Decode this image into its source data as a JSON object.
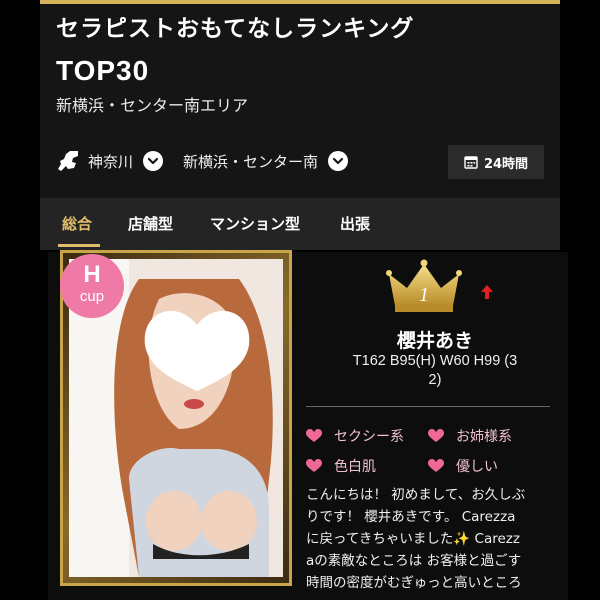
{
  "page": {
    "title_line1": "セラピストおもてなしランキング",
    "title_line2": "TOP30",
    "area": "新横浜・センター南エリア"
  },
  "filters": {
    "prefecture": "神奈川",
    "area": "新横浜・センター南",
    "hours": "24時間",
    "prefecture_icon": "kanagawa-map-icon",
    "chevron_icon": "chevron-down-icon",
    "calendar_icon": "calendar-icon"
  },
  "tabs": [
    {
      "label": "総合",
      "active": true
    },
    {
      "label": "店舗型",
      "active": false
    },
    {
      "label": "マンション型",
      "active": false
    },
    {
      "label": "出張",
      "active": false
    }
  ],
  "therapist": {
    "cup_letter": "H",
    "cup_label": "cup",
    "rank": "1",
    "rank_trend": "up",
    "name": "櫻井あき",
    "stats_line1": "T162 B95(H) W60 H99 (3",
    "stats_line2": "2)",
    "tags": [
      "セクシー系",
      "お姉様系",
      "色白肌",
      "優しい"
    ],
    "description_lines": [
      "こんにちは！ 初めまして、お久しぶ",
      "りです！ 櫻井あきです。 Carezza",
      "に戻ってきちゃいました✨ Carezz",
      "aの素敵なところは お客様と過ごす",
      "時間の密度がむぎゅっと高いところ"
    ]
  },
  "colors": {
    "accent_gold": "#e0bc6a",
    "badge_pink": "#ee7aa5",
    "heart_pink": "#ee6a94",
    "trend_red": "#e02020"
  }
}
